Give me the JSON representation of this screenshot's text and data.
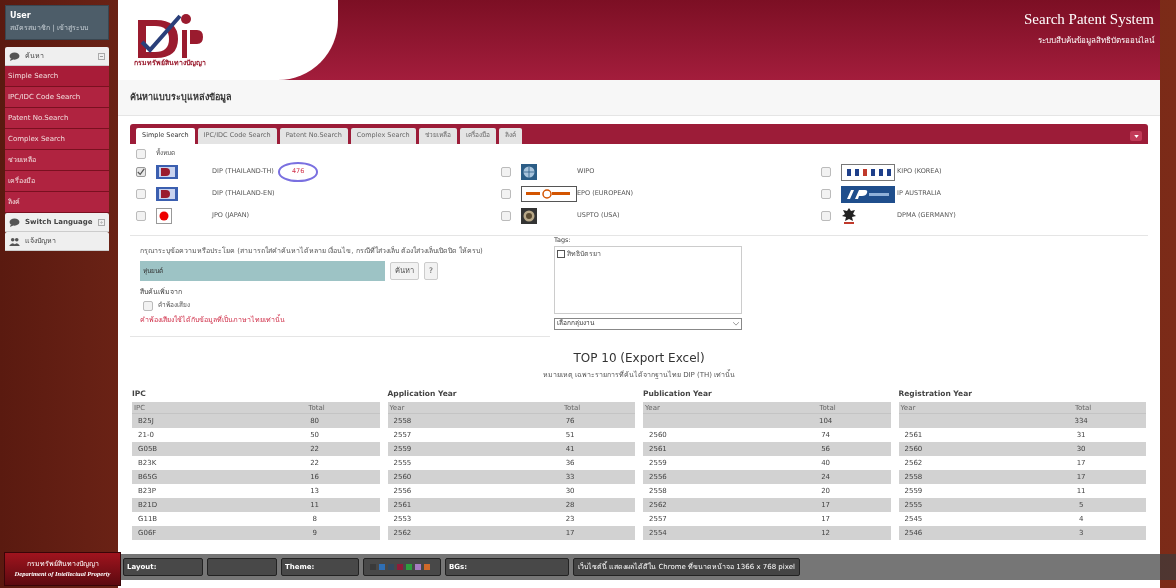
{
  "header": {
    "title": "Search Patent System",
    "subtitle": "ระบบสืบค้นข้อมูลสิทธิบัตรออนไลน์"
  },
  "sidebar": {
    "user": {
      "name": "User",
      "links": "สมัครสมาชิก | เข้าสู่ระบบ"
    },
    "groups": [
      {
        "label": "ค้นหา",
        "expanded": true,
        "items": [
          {
            "label": "Simple Search",
            "selected": true
          },
          {
            "label": "IPC/IDC Code Search",
            "selected": false
          },
          {
            "label": "Patent No.Search",
            "selected": false
          },
          {
            "label": "Complex Search",
            "selected": false
          },
          {
            "label": "ช่วยเหลือ",
            "selected": false
          },
          {
            "label": "เครื่องมือ",
            "selected": false
          },
          {
            "label": "ลิงค์",
            "selected": false
          }
        ]
      },
      {
        "label": "Switch Language",
        "expanded": false
      },
      {
        "label": "แจ้งปัญหา"
      }
    ]
  },
  "logo_caption": "กรมทรัพย์สินทางปัญญา",
  "page_title": "ค้นหาแบบระบุแหล่งข้อมูล",
  "tabs": [
    {
      "label": "Simple Search",
      "selected": true
    },
    {
      "label": "IPC/IDC Code Search",
      "selected": false
    },
    {
      "label": "Patent No.Search",
      "selected": false
    },
    {
      "label": "Complex Search",
      "selected": false
    },
    {
      "label": "ช่วยเหลือ",
      "selected": false
    },
    {
      "label": "เครื่องมือ",
      "selected": false
    },
    {
      "label": "ลิงค์",
      "selected": false
    }
  ],
  "select_all": {
    "label": "ทั้งหมด",
    "checked": false
  },
  "sources": [
    {
      "label": "DIP (THAILAND-TH)",
      "checked": true,
      "kind": "dip",
      "count": "476",
      "highlighted": true
    },
    {
      "label": "WIPO",
      "checked": false,
      "kind": "globe"
    },
    {
      "label": "KIPO (KOREA)",
      "checked": false,
      "kind": "kipris"
    },
    {
      "label": "DIP (THAILAND-EN)",
      "checked": false,
      "kind": "dip"
    },
    {
      "label": "EPO (EUROPEAN)",
      "checked": false,
      "kind": "espacenet"
    },
    {
      "label": "IP AUSTRALIA",
      "checked": false,
      "kind": "ipaus"
    },
    {
      "label": "JPO (JAPAN)",
      "checked": false,
      "kind": "sun"
    },
    {
      "label": "USPTO (USA)",
      "checked": false,
      "kind": "seal"
    },
    {
      "label": "DPMA (GERMANY)",
      "checked": false,
      "kind": "eagle"
    }
  ],
  "search": {
    "instruction": "กรุณาระบุข้อความหรือประโยค (สามารถใส่คำค้นหาได้หลาย เงื่อนไข, กรณีที่ใส่วงเล็บ ต้องใส่วงเล็บเปิดปิด ให้ครบ)",
    "value": "หุ่นยนต์",
    "buttons": [
      "ค้นหา",
      "?"
    ],
    "more_label": "สืบค้นเพิ่มจาก",
    "options": [
      {
        "label": "คำพ้องเสียง",
        "checked": false
      }
    ],
    "note": "คำพ้องเสียงใช้ได้กับข้อมูลที่เป็นภาษาไทยเท่านั้น"
  },
  "tags": {
    "label": "Tags:",
    "items": [
      {
        "label": "สิทธิบัตรยา",
        "checked": false
      }
    ],
    "select": "เลือกกลุ่มงาน"
  },
  "top10": {
    "title": "TOP 10 (Export Excel)",
    "note": "หมายเหตุ เฉพาะรายการที่ค้นได้จากฐานไทย DIP (TH) เท่านั้น",
    "tables": [
      {
        "title": "IPC",
        "columns": [
          "IPC",
          "Total"
        ],
        "rows": [
          [
            "B25J",
            "80"
          ],
          [
            "21-0",
            "50"
          ],
          [
            "G05B",
            "22"
          ],
          [
            "B23K",
            "22"
          ],
          [
            "B65G",
            "16"
          ],
          [
            "B23P",
            "13"
          ],
          [
            "B21D",
            "11"
          ],
          [
            "G11B",
            "8"
          ],
          [
            "G06F",
            "9"
          ]
        ]
      },
      {
        "title": "Application Year",
        "columns": [
          "Year",
          "Total"
        ],
        "rows": [
          [
            "2558",
            "76"
          ],
          [
            "2557",
            "51"
          ],
          [
            "2559",
            "41"
          ],
          [
            "2555",
            "36"
          ],
          [
            "2560",
            "33"
          ],
          [
            "2556",
            "30"
          ],
          [
            "2561",
            "28"
          ],
          [
            "2553",
            "23"
          ],
          [
            "2562",
            "17"
          ]
        ]
      },
      {
        "title": "Publication Year",
        "columns": [
          "Year",
          "Total"
        ],
        "rows": [
          [
            null,
            "104"
          ],
          [
            "2560",
            "74"
          ],
          [
            "2561",
            "56"
          ],
          [
            "2559",
            "40"
          ],
          [
            "2556",
            "24"
          ],
          [
            "2558",
            "20"
          ],
          [
            "2562",
            "17"
          ],
          [
            "2557",
            "17"
          ],
          [
            "2554",
            "12"
          ]
        ]
      },
      {
        "title": "Registration Year",
        "columns": [
          "Year",
          "Total"
        ],
        "rows": [
          [
            null,
            "334"
          ],
          [
            "2561",
            "31"
          ],
          [
            "2560",
            "30"
          ],
          [
            "2562",
            "17"
          ],
          [
            "2558",
            "17"
          ],
          [
            "2559",
            "11"
          ],
          [
            "2555",
            "5"
          ],
          [
            "2545",
            "4"
          ],
          [
            "2546",
            "3"
          ]
        ]
      }
    ]
  },
  "footer": {
    "org_th": "กรมทรัพย์สินทางปัญญา",
    "org_en": "Department of Intellectual Property",
    "layout_label": "Layout:",
    "theme_label": "Theme:",
    "swatches": [
      {
        "color": "#3a3a3a"
      },
      {
        "color": "#2f6fb5"
      },
      {
        "color": "#34495e"
      },
      {
        "color": "#8e1b3a"
      },
      {
        "color": "#2e9e3e"
      },
      {
        "color": "#a77bc2"
      },
      {
        "color": "#d0692a"
      }
    ],
    "bgs_label": "BGs:",
    "notice": "เว็บไซต์นี้ แสดงผลได้ดีใน Chrome ที่ขนาดหน้าจอ 1366 x 768 pixel"
  }
}
